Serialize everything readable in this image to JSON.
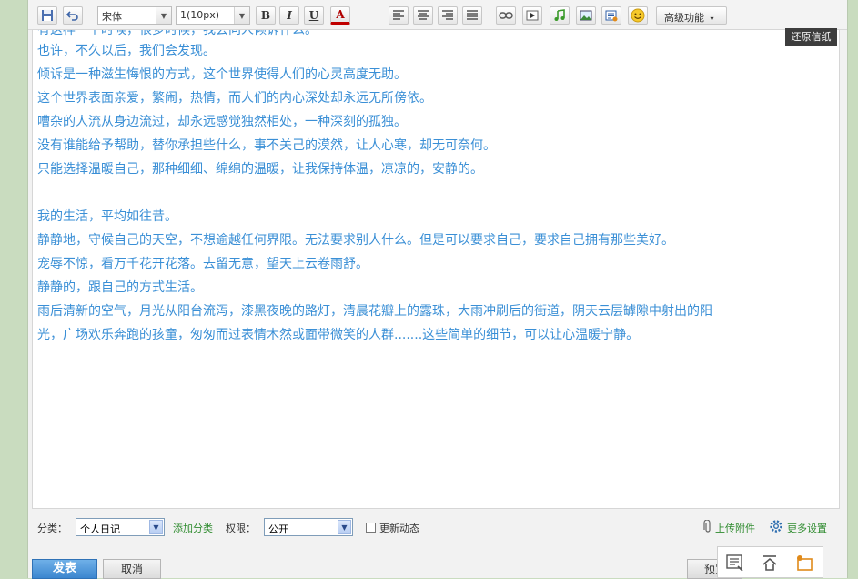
{
  "toolbar": {
    "font_name": "宋体",
    "font_size": "1(10px)",
    "bold": "B",
    "italic": "I",
    "underline": "U",
    "font_color": "A",
    "advanced": "高级功能"
  },
  "editor": {
    "restore_paper": "还原信纸",
    "lines": [
      "有这样一个时候，很多时候，我会向人倾诉什么。",
      "也许，不久以后，我们会发现。",
      "倾诉是一种滋生悔恨的方式，这个世界使得人们的心灵高度无助。",
      "这个世界表面亲爱，繁闹，热情，而人们的内心深处却永远无所傍依。",
      "嘈杂的人流从身边流过，却永远感觉独然相处，一种深刻的孤独。",
      "没有谁能给予帮助，替你承担些什么，事不关己的漠然，让人心寒，却无可奈何。",
      "只能选择温暖自己，那种细细、绵绵的温暖，让我保持体温，凉凉的，安静的。",
      "",
      "我的生活，平均如往昔。",
      "静静地，守候自己的天空，不想逾越任何界限。无法要求别人什么。但是可以要求自己，要求自己拥有那些美好。",
      "宠辱不惊，看万千花开花落。去留无意，望天上云卷雨舒。",
      "静静的，跟自己的方式生活。",
      "雨后清新的空气，月光从阳台流泻，漆黑夜晚的路灯，清晨花瓣上的露珠，大雨冲刷后的街道，阴天云层罅隙中射出的阳",
      "光，广场欢乐奔跑的孩童，匆匆而过表情木然或面带微笑的人群.......这些简单的细节，可以让心温暖宁静。"
    ]
  },
  "bottom": {
    "category_label": "分类：",
    "category_value": "个人日记",
    "add_category": "添加分类",
    "permission_label": "权限：",
    "permission_value": "公开",
    "update_feed": "更新动态",
    "upload_attachment": "上传附件",
    "more_settings": "更多设置"
  },
  "actions": {
    "publish": "发表",
    "cancel": "取消",
    "preview": "预览"
  },
  "colors": {
    "text_blue": "#3a8fd6",
    "link_green": "#2e8b2e",
    "publish_blue": "#3b86cf"
  }
}
